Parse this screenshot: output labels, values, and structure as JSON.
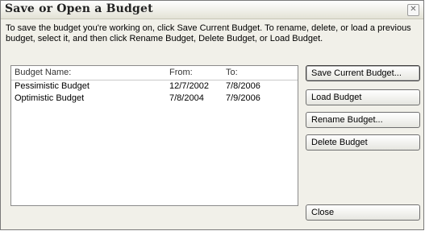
{
  "dialog": {
    "title": "Save or Open a Budget",
    "instructions": "To save the budget you're working on, click Save Current Budget. To rename, delete, or load a previous budget, select it, and then click Rename Budget, Delete Budget, or Load Budget."
  },
  "list": {
    "columns": [
      "Budget Name:",
      "From:",
      "To:"
    ],
    "rows": [
      {
        "name": "Pessimistic Budget",
        "from": "12/7/2002",
        "to": "7/8/2006"
      },
      {
        "name": "Optimistic Budget",
        "from": "7/8/2004",
        "to": "7/9/2006"
      }
    ]
  },
  "buttons": {
    "save": "Save Current Budget...",
    "load": "Load Budget",
    "rename": "Rename Budget...",
    "delete": "Delete Budget",
    "close": "Close"
  },
  "icons": {
    "close": "close-icon"
  }
}
